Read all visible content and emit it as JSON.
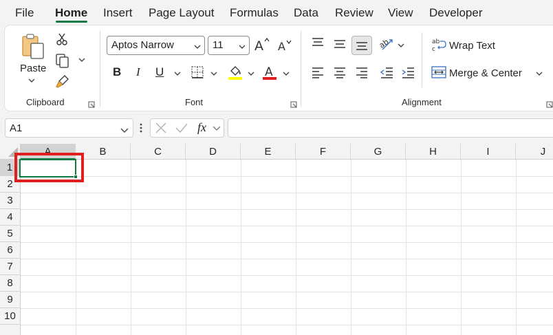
{
  "menu": {
    "tabs": [
      {
        "label": "File",
        "active": false
      },
      {
        "label": "Home",
        "active": true
      },
      {
        "label": "Insert",
        "active": false
      },
      {
        "label": "Page Layout",
        "active": false
      },
      {
        "label": "Formulas",
        "active": false
      },
      {
        "label": "Data",
        "active": false
      },
      {
        "label": "Review",
        "active": false
      },
      {
        "label": "View",
        "active": false
      },
      {
        "label": "Developer",
        "active": false
      }
    ]
  },
  "ribbon": {
    "clipboard": {
      "paste_label": "Paste",
      "group_label": "Clipboard"
    },
    "font": {
      "font_name": "Aptos Narrow",
      "font_size": "11",
      "group_label": "Font",
      "bold": "B",
      "italic": "I",
      "underline": "U",
      "highlight_color": "#ffff00",
      "font_color": "#e02020"
    },
    "alignment": {
      "wrap_text_label": "Wrap Text",
      "merge_center_label": "Merge & Center",
      "group_label": "Alignment"
    }
  },
  "formula_bar": {
    "name_box": "A1",
    "fx_label": "fx",
    "formula": ""
  },
  "grid": {
    "columns": [
      "A",
      "B",
      "C",
      "D",
      "E",
      "F",
      "G",
      "H",
      "I",
      "J"
    ],
    "rows": [
      "1",
      "2",
      "3",
      "4",
      "5",
      "6",
      "7",
      "8",
      "9",
      "10"
    ],
    "selected_column": "A",
    "selected_row": "1"
  },
  "colors": {
    "accent": "#117b45",
    "annotation": "#e02020"
  }
}
